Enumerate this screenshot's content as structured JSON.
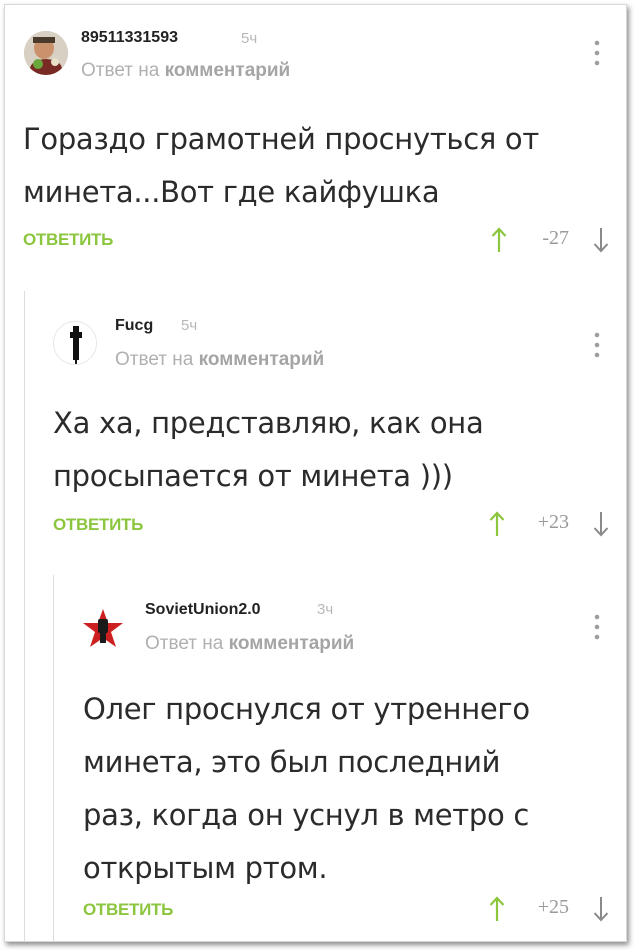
{
  "comments": [
    {
      "author": "89511331593",
      "time": "5ч",
      "reply_prefix": "Ответ на",
      "reply_target": "комментарий",
      "text_lines": [
        "Гораздо грамотней проснуться от",
        "минета...Вот где кайфушка"
      ],
      "reply_label": "ОТВЕТИТЬ",
      "rating": "-27"
    },
    {
      "author": "Fucg",
      "time": "5ч",
      "reply_prefix": "Ответ на",
      "reply_target": "комментарий",
      "text_lines": [
        "Ха ха, представляю, как она",
        "просыпается от минета )))"
      ],
      "reply_label": "ОТВЕТИТЬ",
      "rating": "+23"
    },
    {
      "author": "SovietUnion2.0",
      "time": "3ч",
      "reply_prefix": "Ответ на",
      "reply_target": "комментарий",
      "text_lines": [
        "Олег проснулся от утреннего",
        "минета, это был последний",
        "раз, когда он уснул в метро с",
        "открытым ртом."
      ],
      "reply_label": "ОТВЕТИТЬ",
      "rating": "+25"
    }
  ],
  "colors": {
    "accent_green": "#8cc63f",
    "text": "#2b2b2b",
    "muted": "#b0b0b0"
  }
}
